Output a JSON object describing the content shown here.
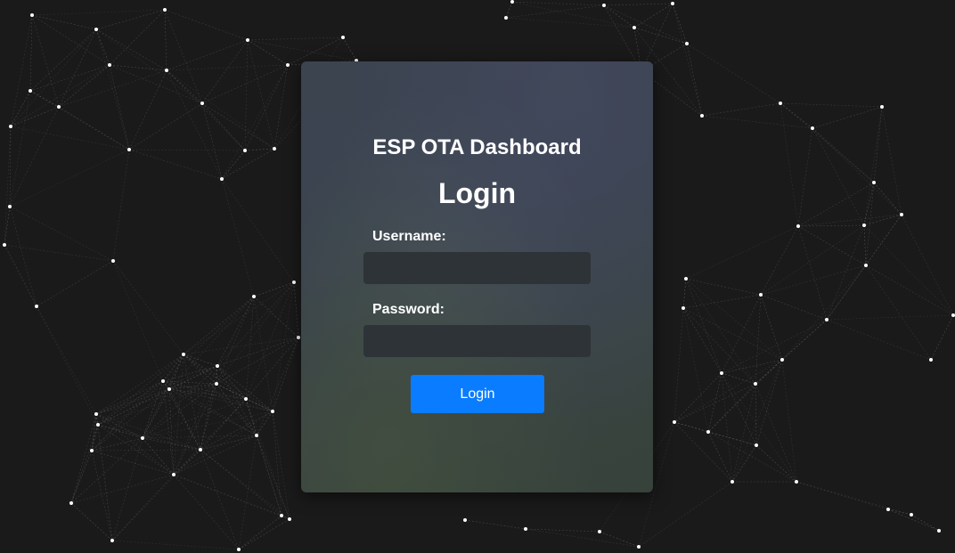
{
  "page": {
    "app_title": "ESP OTA Dashboard",
    "heading": "Login"
  },
  "form": {
    "username_label": "Username:",
    "username_value": "",
    "password_label": "Password:",
    "password_value": "",
    "submit_label": "Login"
  },
  "colors": {
    "background": "#1a1a1a",
    "button": "#0a7cff",
    "input_background": "#2d3337",
    "text": "#ffffff"
  }
}
